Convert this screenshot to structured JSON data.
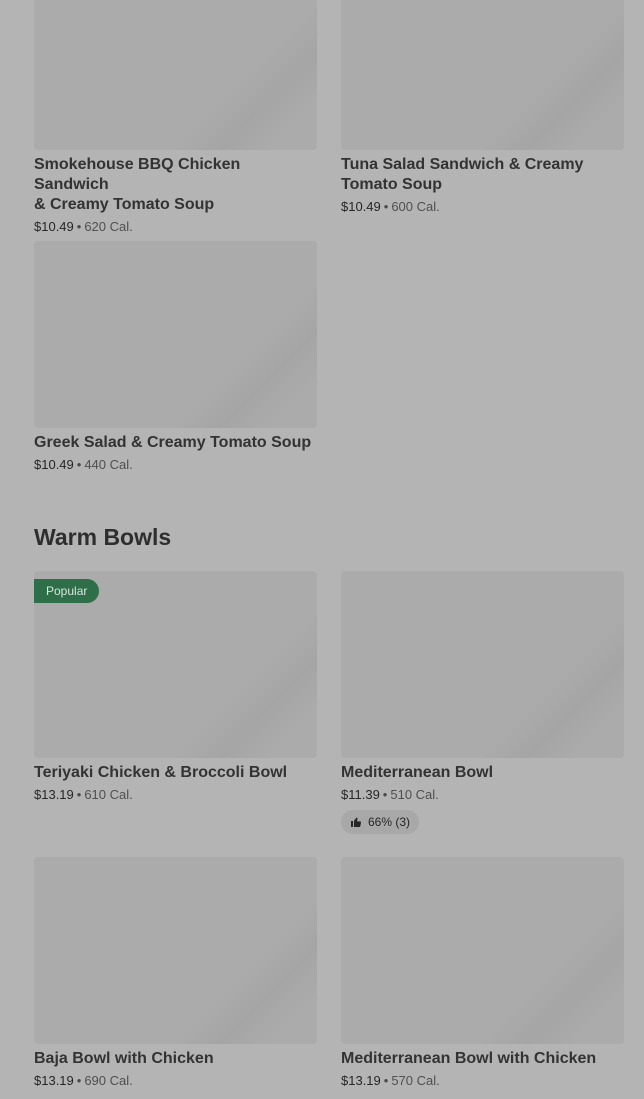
{
  "colors": {
    "background": "#b4b4b4",
    "thumbnail": "#ababab",
    "badge": "#2e6f49"
  },
  "cards_top": [
    {
      "title_l1": "Smokehouse BBQ Chicken Sandwich",
      "title_l2": "& Creamy Tomato Soup",
      "price": "$10.49",
      "calories": "620 Cal."
    },
    {
      "title_l1": "Tuna Salad Sandwich & Creamy",
      "title_l2": "Tomato Soup",
      "price": "$10.49",
      "calories": "600 Cal."
    },
    {
      "title_l1": "Greek Salad & Creamy Tomato Soup",
      "price": "$10.49",
      "calories": "440 Cal."
    }
  ],
  "separator": "•",
  "warm_bowls": {
    "heading": "Warm Bowls",
    "items": [
      {
        "title": "Teriyaki Chicken & Broccoli Bowl",
        "price": "$13.19",
        "calories": "610 Cal.",
        "badge": "Popular"
      },
      {
        "title": "Mediterranean Bowl",
        "price": "$11.39",
        "calories": "510 Cal.",
        "rating": "66% (3)",
        "rating_icon": "thumbs-up-icon"
      },
      {
        "title": "Baja Bowl with Chicken",
        "price": "$13.19",
        "calories": "690 Cal."
      },
      {
        "title": "Mediterranean Bowl with Chicken",
        "price": "$13.19",
        "calories": "570 Cal."
      }
    ]
  }
}
